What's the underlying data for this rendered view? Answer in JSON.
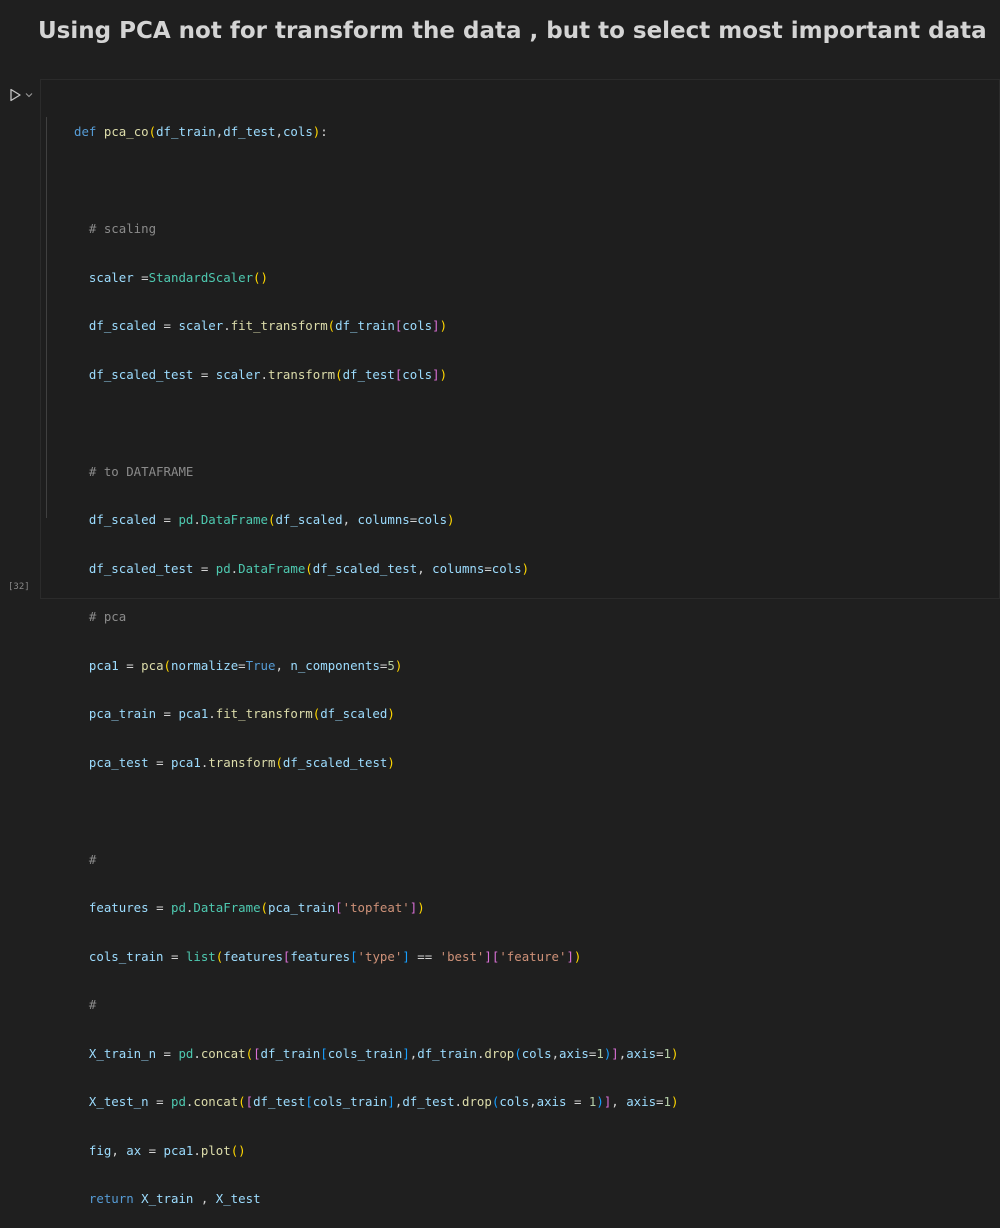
{
  "markdown": {
    "heading": "Using PCA not for transform the data , but to select most important data"
  },
  "cell": {
    "execution_count": "[32]",
    "run_icon": "play-icon",
    "collapse_icon": "chevron-down-icon",
    "code_lines": [
      "def pca_co(df_train,df_test,cols):",
      "",
      "  # scaling",
      "  scaler =StandardScaler()",
      "  df_scaled = scaler.fit_transform(df_train[cols])",
      "  df_scaled_test = scaler.transform(df_test[cols])",
      "",
      "  # to DATAFRAME",
      "  df_scaled = pd.DataFrame(df_scaled, columns=cols)",
      "  df_scaled_test = pd.DataFrame(df_scaled_test, columns=cols)",
      "  # pca",
      "  pca1 = pca(normalize=True, n_components=5)",
      "  pca_train = pca1.fit_transform(df_scaled)",
      "  pca_test = pca1.transform(df_scaled_test)",
      "",
      "  #",
      "  features = pd.DataFrame(pca_train['topfeat'])",
      "  cols_train = list(features[features['type'] == 'best']['feature'])",
      "  #",
      "  X_train_n = pd.concat([df_train[cols_train],df_train.drop(cols,axis=1)],axis=1)",
      "  X_test_n = pd.concat([df_test[cols_train],df_test.drop(cols,axis = 1)], axis=1)",
      "  fig, ax = pca1.plot()",
      "  return X_train , X_test"
    ]
  },
  "colors": {
    "background": "#1f1f1f",
    "keyword": "#569cd6",
    "function": "#dcdcaa",
    "string": "#ce9178",
    "number": "#b5cea8",
    "comment": "#6a9955"
  }
}
